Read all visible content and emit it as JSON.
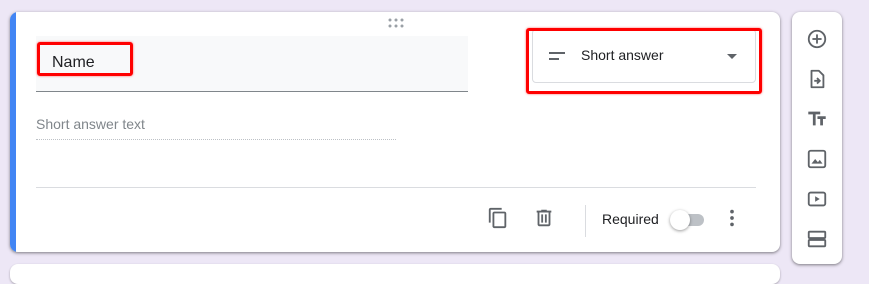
{
  "question": {
    "title": "Name",
    "type_selected": "Short answer",
    "answer_placeholder": "Short answer text",
    "required_label": "Required",
    "required": false
  },
  "footer_icons": [
    "duplicate-icon",
    "delete-icon",
    "more-vert-icon"
  ],
  "toolbar_icons": [
    "add-question-icon",
    "import-questions-icon",
    "add-title-icon",
    "add-image-icon",
    "add-video-icon",
    "add-section-icon"
  ],
  "colors": {
    "accent": "#4285f4",
    "highlight": "#ff0000",
    "background": "#ede7f6"
  }
}
